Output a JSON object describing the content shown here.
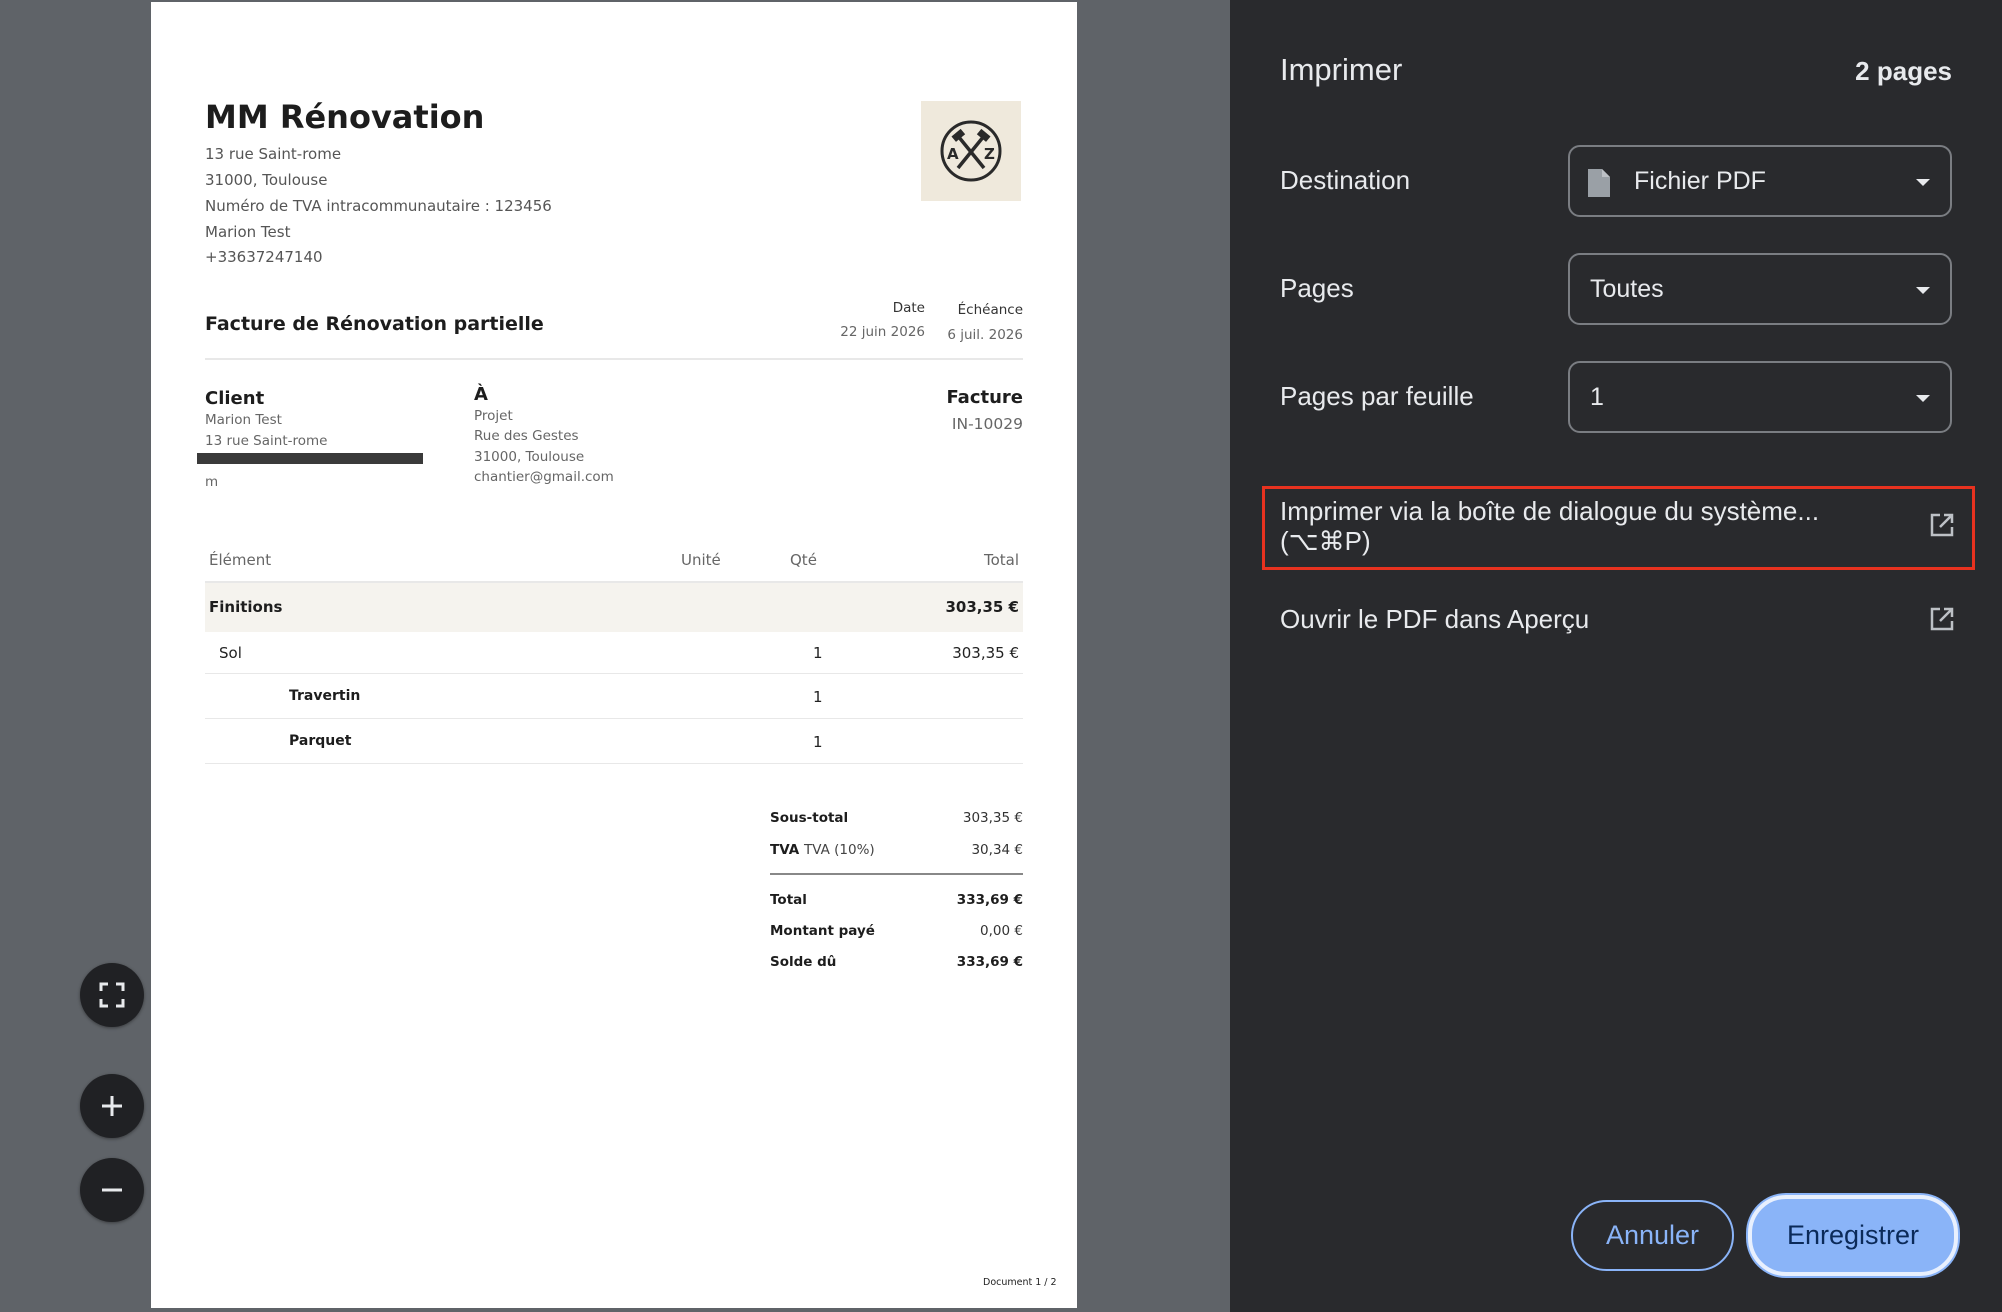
{
  "invoice": {
    "company": "MM Rénovation",
    "address_lines": [
      "13 rue Saint-rome",
      "31000, Toulouse",
      "Numéro de TVA intracommunautaire : 123456",
      "Marion Test",
      "+33637247140"
    ],
    "logo_letters": "AXZ",
    "title": "Facture de Rénovation partielle",
    "date_label": "Date",
    "date_value": "22 juin 2026",
    "due_label": "Échéance",
    "due_value": "6 juil. 2026",
    "client_heading": "Client",
    "client_lines": [
      "Marion Test",
      "13 rue Saint-rome"
    ],
    "client_tail": "m",
    "to_heading": "À",
    "to_lines": [
      "Projet",
      "Rue des Gestes",
      "31000, Toulouse",
      "chantier@gmail.com"
    ],
    "doc_type": "Facture",
    "doc_number": "IN-10029",
    "columns": [
      "Élément",
      "Unité",
      "Qté",
      "Total"
    ],
    "group": {
      "name": "Finitions",
      "total": "303,35 €"
    },
    "rows": [
      {
        "name": "Sol",
        "qty": "1",
        "total": "303,35 €"
      },
      {
        "name": "Travertin",
        "qty": "1",
        "total": ""
      },
      {
        "name": "Parquet",
        "qty": "1",
        "total": ""
      }
    ],
    "summary": {
      "subtotal_label": "Sous-total",
      "subtotal": "303,35 €",
      "tva_label": "TVA",
      "tva_note": "TVA (10%)",
      "tva": "30,34 €",
      "total_label": "Total",
      "total": "333,69 €",
      "paid_label": "Montant payé",
      "paid": "0,00 €",
      "due_label": "Solde dû",
      "due": "333,69 €"
    },
    "footer": "Document 1 / 2"
  },
  "zoom_controls": {
    "fit": "fit-to-page-icon",
    "zoom_in": "plus-icon",
    "zoom_out": "minus-icon"
  },
  "sidebar": {
    "title": "Imprimer",
    "page_count": "2 pages",
    "destination_label": "Destination",
    "destination_value": "Fichier PDF",
    "pages_label": "Pages",
    "pages_value": "Toutes",
    "per_sheet_label": "Pages par feuille",
    "per_sheet_value": "1",
    "system_dialog_line1": "Imprimer via la boîte de dialogue du système...",
    "system_dialog_line2": "(⌥⌘P)",
    "open_pdf": "Ouvrir le PDF dans Aperçu",
    "cancel": "Annuler",
    "save": "Enregistrer"
  },
  "colors": {
    "accent": "#8ab4f8",
    "sidebar_bg": "#292a2d",
    "highlight": "#e8321f"
  }
}
